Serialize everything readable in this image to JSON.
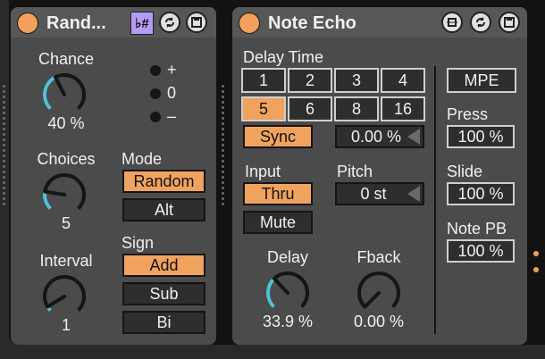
{
  "random": {
    "title": "Rand...",
    "header_badge": "♭#",
    "chance": {
      "label": "Chance",
      "value": "40 %",
      "level": 0.4
    },
    "sign_dots": [
      "+",
      "0",
      "–"
    ],
    "choices": {
      "label": "Choices",
      "value": "5",
      "level": 0.2
    },
    "interval": {
      "label": "Interval",
      "value": "1",
      "level": 0.05
    },
    "mode": {
      "label": "Mode",
      "options": [
        "Random",
        "Alt"
      ],
      "selected": "Random"
    },
    "sign": {
      "label": "Sign",
      "options": [
        "Add",
        "Sub",
        "Bi"
      ],
      "selected": "Add"
    }
  },
  "echo": {
    "title": "Note Echo",
    "delay_time": {
      "label": "Delay Time",
      "buttons": [
        "1",
        "2",
        "3",
        "4",
        "5",
        "6",
        "8",
        "16"
      ],
      "selected": "5",
      "sync_label": "Sync",
      "offset_value": "0.00 %"
    },
    "input": {
      "label": "Input",
      "options": [
        "Thru",
        "Mute"
      ],
      "selected": "Thru"
    },
    "pitch": {
      "label": "Pitch",
      "value": "0 st"
    },
    "delay": {
      "label": "Delay",
      "value": "33.9 %",
      "level": 0.339
    },
    "fback": {
      "label": "Fback",
      "value": "0.00 %",
      "level": 0.0
    },
    "mpe": {
      "label": "MPE"
    },
    "press": {
      "label": "Press",
      "value": "100 %"
    },
    "slide": {
      "label": "Slide",
      "value": "100 %"
    },
    "note_pb": {
      "label": "Note PB",
      "value": "100 %"
    }
  },
  "colors": {
    "accent": "#f0a35f",
    "knob_arc": "#4ec2d8",
    "panel": "#4b4b4b"
  }
}
